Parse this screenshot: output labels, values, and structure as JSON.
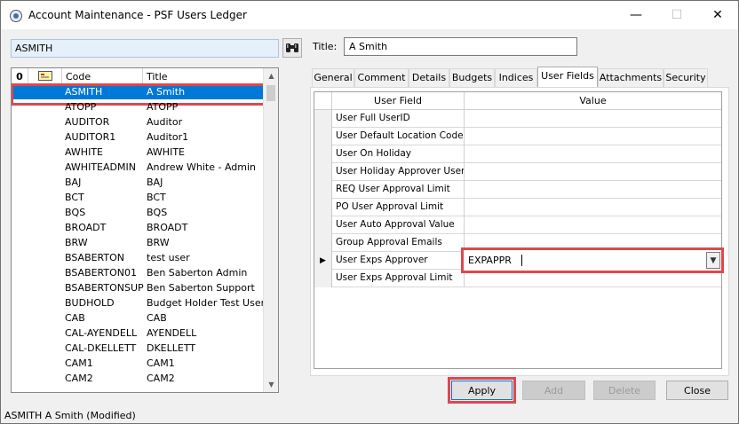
{
  "window": {
    "title": "Account Maintenance - PSF Users Ledger",
    "minimize": "—",
    "maximize": "☐",
    "close": "✕"
  },
  "search": {
    "value": "ASMITH"
  },
  "list": {
    "headers": {
      "attach": "0",
      "note": "",
      "code": "Code",
      "title": "Title"
    },
    "rows": [
      {
        "code": "ASMITH",
        "title": "A Smith"
      },
      {
        "code": "ATOPP",
        "title": "ATOPP"
      },
      {
        "code": "AUDITOR",
        "title": "Auditor"
      },
      {
        "code": "AUDITOR1",
        "title": "Auditor1"
      },
      {
        "code": "AWHITE",
        "title": "AWHITE"
      },
      {
        "code": "AWHITEADMIN",
        "title": "Andrew White - Admin"
      },
      {
        "code": "BAJ",
        "title": "BAJ"
      },
      {
        "code": "BCT",
        "title": "BCT"
      },
      {
        "code": "BQS",
        "title": "BQS"
      },
      {
        "code": "BROADT",
        "title": "BROADT"
      },
      {
        "code": "BRW",
        "title": "BRW"
      },
      {
        "code": "BSABERTON",
        "title": "test user"
      },
      {
        "code": "BSABERTON01",
        "title": "Ben Saberton Admin"
      },
      {
        "code": "BSABERTONSUP",
        "title": "Ben Saberton Support"
      },
      {
        "code": "BUDHOLD",
        "title": "Budget Holder Test User"
      },
      {
        "code": "CAB",
        "title": "CAB"
      },
      {
        "code": "CAL-AYENDELL",
        "title": "AYENDELL"
      },
      {
        "code": "CAL-DKELLETT",
        "title": "DKELLETT"
      },
      {
        "code": "CAM1",
        "title": "CAM1"
      },
      {
        "code": "CAM2",
        "title": "CAM2"
      }
    ]
  },
  "title_field": {
    "label": "Title:",
    "value": "A Smith"
  },
  "tabs": [
    {
      "label": "General"
    },
    {
      "label": "Comment"
    },
    {
      "label": "Details"
    },
    {
      "label": "Budgets"
    },
    {
      "label": "Indices"
    },
    {
      "label": "User Fields"
    },
    {
      "label": "Attachments"
    },
    {
      "label": "Security"
    }
  ],
  "grid": {
    "headers": {
      "field": "User Field",
      "value": "Value"
    },
    "rows": [
      {
        "field": "User Full UserID",
        "value": ""
      },
      {
        "field": "User Default Location Code",
        "value": ""
      },
      {
        "field": "User On Holiday",
        "value": ""
      },
      {
        "field": "User Holiday Approver User",
        "value": ""
      },
      {
        "field": "REQ User Approval Limit",
        "value": ""
      },
      {
        "field": "PO User Approval Limit",
        "value": ""
      },
      {
        "field": "User Auto Approval Value",
        "value": ""
      },
      {
        "field": "Group Approval Emails",
        "value": ""
      },
      {
        "field": "User Exps Approver",
        "value": "EXPAPPR"
      },
      {
        "field": "User Exps Approval Limit",
        "value": ""
      }
    ],
    "current_row_marker": "▶"
  },
  "buttons": {
    "apply": "Apply",
    "add": "Add",
    "delete": "Delete",
    "close": "Close"
  },
  "status": {
    "text": "ASMITH A Smith (Modified)"
  },
  "colors": {
    "selection": "#0078d7",
    "highlight": "#e0474c"
  }
}
